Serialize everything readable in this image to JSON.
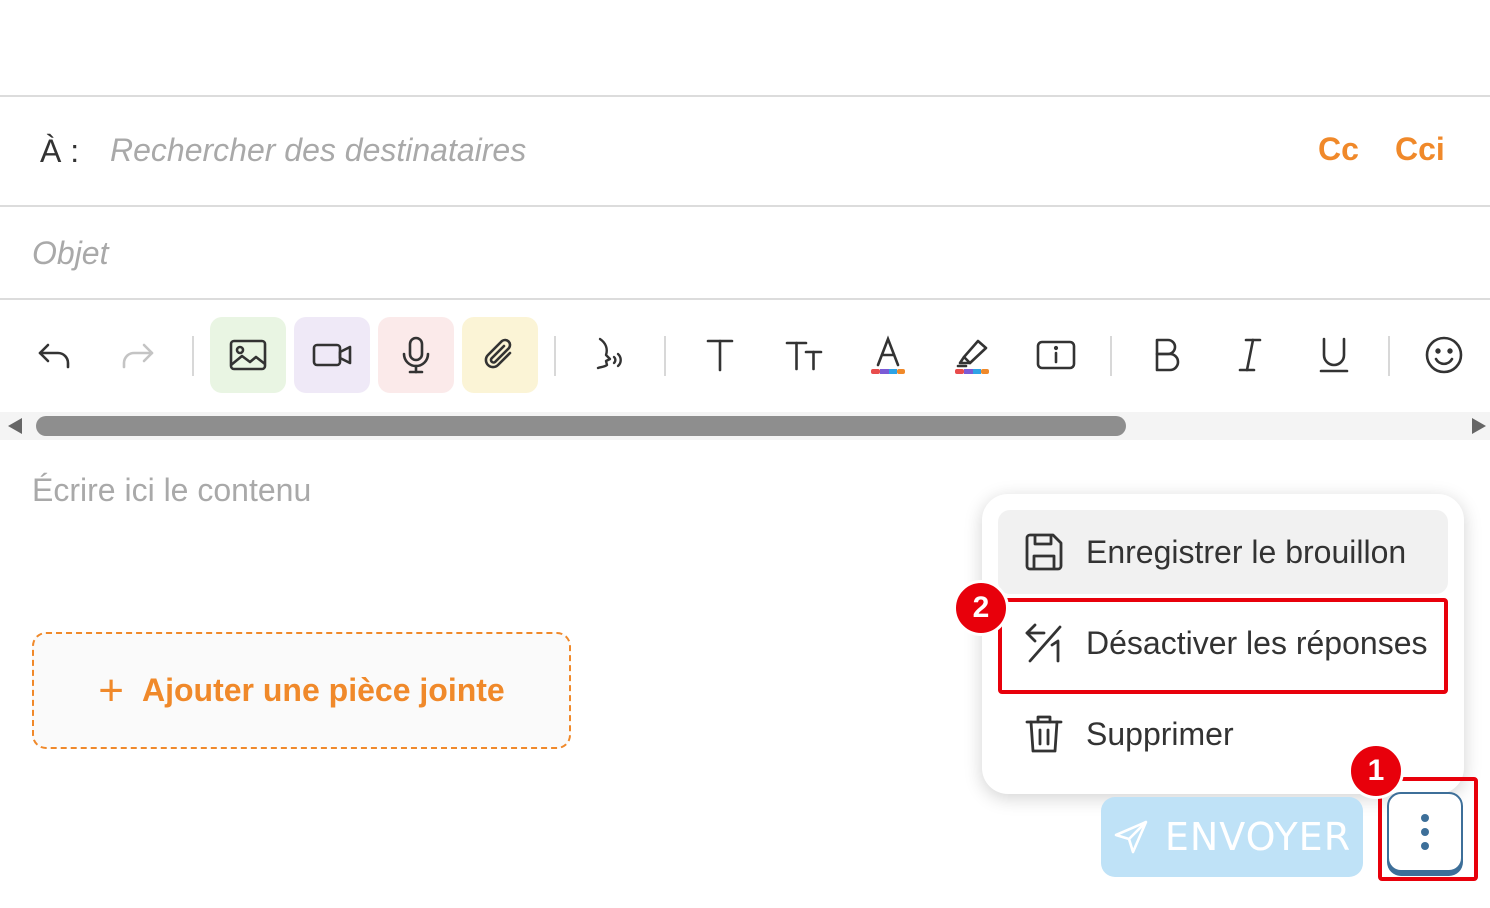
{
  "compose": {
    "to_label": "À :",
    "to_placeholder": "Rechercher des destinataires",
    "cc_label": "Cc",
    "bcc_label": "Cci",
    "subject_placeholder": "Objet",
    "body_placeholder": "Écrire ici le contenu",
    "attach_label": "Ajouter une pièce jointe",
    "attach_icon": "+"
  },
  "toolbar": {
    "buttons": [
      "undo-icon",
      "redo-icon",
      "image-icon",
      "video-icon",
      "microphone-icon",
      "paperclip-icon",
      "speech-icon",
      "text-icon",
      "text-size-icon",
      "text-color-icon",
      "highlight-icon",
      "info-box-icon",
      "bold-icon",
      "italic-icon",
      "underline-icon",
      "emoji-icon"
    ]
  },
  "menu": {
    "items": [
      {
        "label": "Enregistrer le brouillon",
        "icon": "save-icon"
      },
      {
        "label": "Désactiver les réponses",
        "icon": "disable-replies-icon"
      },
      {
        "label": "Supprimer",
        "icon": "trash-icon"
      }
    ]
  },
  "actions": {
    "send_label": "ENVOYER",
    "more_icon": "vertical-dots-icon"
  },
  "annotations": {
    "badge_1": "1",
    "badge_2": "2"
  },
  "colors": {
    "accent": "#f0892a",
    "send_bg": "#bfe2f7",
    "annotation_red": "#e8000b",
    "more_border": "#3d6f99",
    "image_btn_bg": "#e9f5e3",
    "video_btn_bg": "#efe9f7",
    "mic_btn_bg": "#fbeaea",
    "attach_btn_bg": "#fbf4d6"
  }
}
